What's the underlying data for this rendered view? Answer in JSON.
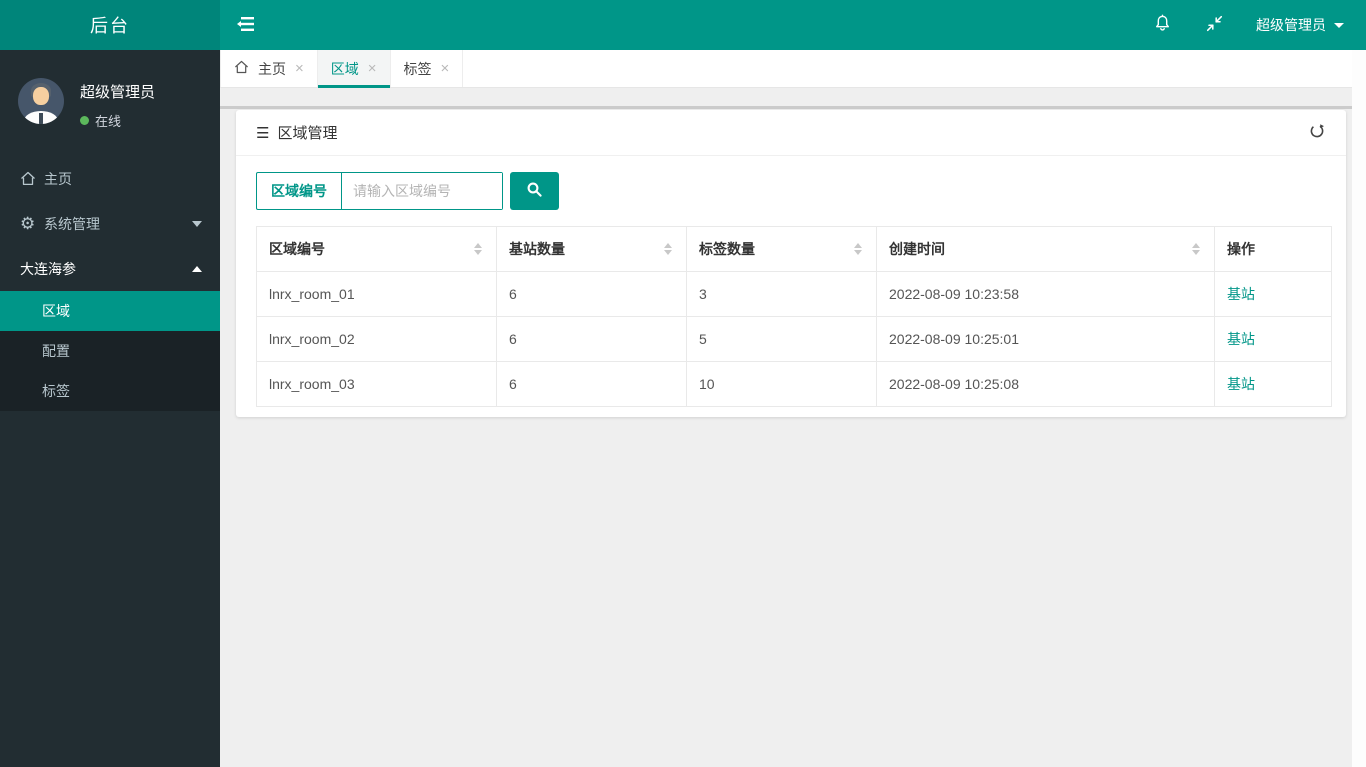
{
  "colors": {
    "accent": "#009688",
    "accent_dark": "#00857a",
    "sidebar_bg": "#222d32",
    "submenu_bg": "#1a2226",
    "status_online": "#5cb85c"
  },
  "navbar": {
    "logo": "后台",
    "user_label": "超级管理员"
  },
  "sidebar": {
    "user": {
      "name": "超级管理员",
      "status": "在线"
    },
    "items": [
      {
        "label": "主页"
      },
      {
        "label": "系统管理"
      },
      {
        "label": "大连海参"
      }
    ],
    "submenu": [
      {
        "label": "区域"
      },
      {
        "label": "配置"
      },
      {
        "label": "标签"
      }
    ]
  },
  "tabs": [
    {
      "label": "主页"
    },
    {
      "label": "区域"
    },
    {
      "label": "标签"
    }
  ],
  "icons": {
    "close": "×",
    "panel_menu": "☰",
    "gear": "⚙"
  },
  "main": {
    "title": "区域管理",
    "search": {
      "label": "区域编号",
      "placeholder": "请输入区域编号"
    },
    "table": {
      "columns": [
        {
          "label": "区域编号"
        },
        {
          "label": "基站数量"
        },
        {
          "label": "标签数量"
        },
        {
          "label": "创建时间"
        },
        {
          "label": "操作"
        }
      ],
      "rows": [
        {
          "region_id": "lnrx_room_01",
          "stations": "6",
          "tags": "3",
          "created": "2022-08-09 10:23:58",
          "action": "基站"
        },
        {
          "region_id": "lnrx_room_02",
          "stations": "6",
          "tags": "5",
          "created": "2022-08-09 10:25:01",
          "action": "基站"
        },
        {
          "region_id": "lnrx_room_03",
          "stations": "6",
          "tags": "10",
          "created": "2022-08-09 10:25:08",
          "action": "基站"
        }
      ]
    }
  }
}
